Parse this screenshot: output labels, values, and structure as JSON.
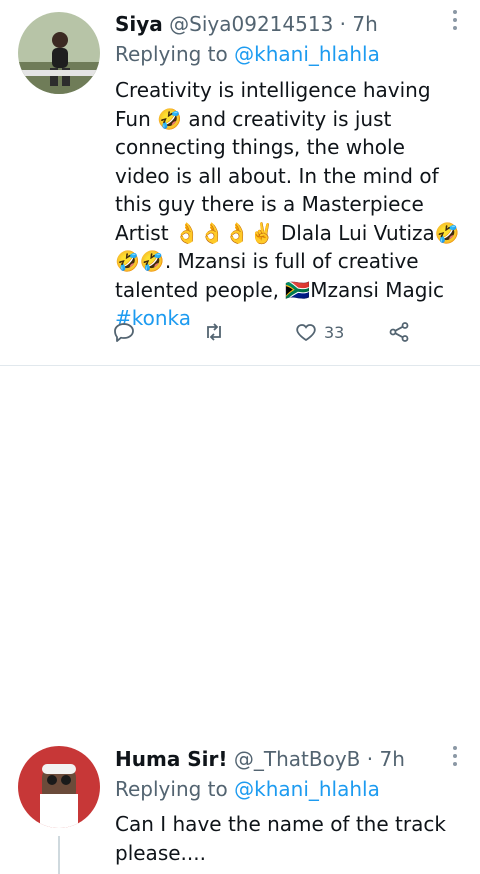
{
  "tweets": [
    {
      "name": "Siya",
      "handle": "@Siya09214513",
      "time_sep": " · ",
      "time": "7h",
      "replying_prefix": "Replying to ",
      "replying_handle": "@khani_hlahla",
      "text_parts": [
        "Creativity is intelligence having Fun",
        "🤣",
        " and creativity is just connecting things, the whole video is all about. In the mind of this guy there is a Masterpiece Artist ",
        "👌👌👌✌️",
        " Dlala Lui Vutiza",
        "🤣🤣🤣",
        ". Mzansi is full of creative talented people, ",
        "🇿🇦",
        "Mzansi Magic "
      ],
      "hashtag": "#konka",
      "likes": "33",
      "icons": [
        "reply-icon",
        "retweet-icon",
        "like-icon",
        "share-icon",
        "more-icon"
      ]
    },
    {
      "name": "Huma Sir!",
      "handle": "@_ThatBoyB",
      "time_sep": " · ",
      "time": "7h",
      "replying_prefix": "Replying to ",
      "replying_handle": "@khani_hlahla",
      "text": "Can I have the name of the track please....",
      "icons": [
        "more-icon"
      ]
    }
  ],
  "colors": {
    "accent": "#1d9bf0",
    "muted": "#536471",
    "text": "#0f1419",
    "divider": "#e1e8ed"
  }
}
